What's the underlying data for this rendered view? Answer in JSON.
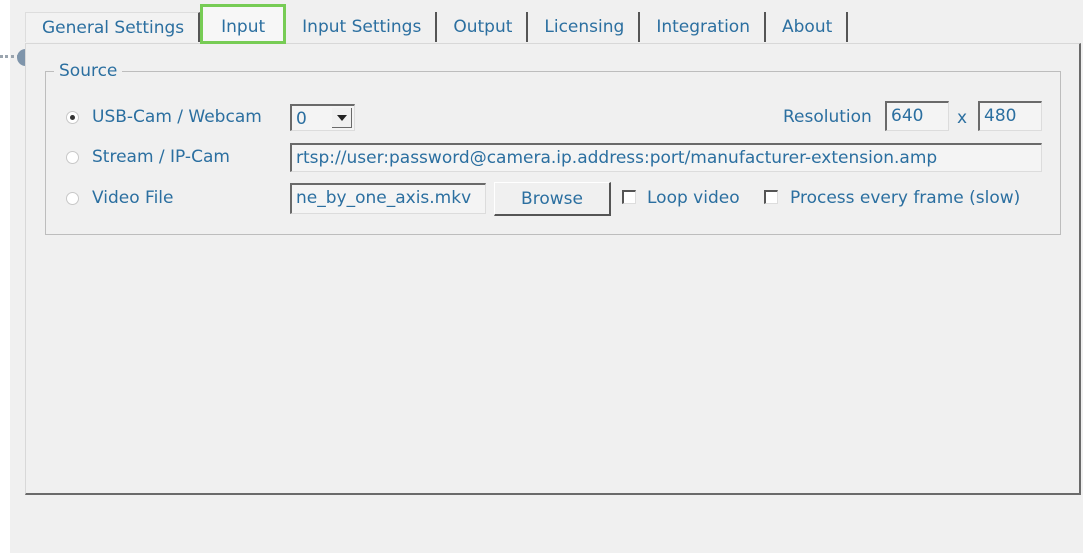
{
  "tabs": [
    {
      "label": "General Settings"
    },
    {
      "label": "Input"
    },
    {
      "label": "Input Settings"
    },
    {
      "label": "Output"
    },
    {
      "label": "Licensing"
    },
    {
      "label": "Integration"
    },
    {
      "label": "About"
    }
  ],
  "active_tab": "Input",
  "source": {
    "title": "Source",
    "usb_label": "USB-Cam / Webcam",
    "usb_device_value": "0",
    "stream_label": "Stream / IP-Cam",
    "stream_url": "rtsp://user:password@camera.ip.address:port/manufacturer-extension.amp",
    "video_file_label": "Video File",
    "video_file_value": "ne_by_one_axis.mkv",
    "browse_label": "Browse",
    "loop_label": "Loop video",
    "process_label": "Process every frame (slow)",
    "resolution_label": "Resolution",
    "resolution_width": "640",
    "resolution_x": "x",
    "resolution_height": "480",
    "selected_source": "USB-Cam / Webcam"
  },
  "colors": {
    "text": "#2b6fa0",
    "highlight": "#77cc55",
    "background": "#f0f0f0"
  }
}
